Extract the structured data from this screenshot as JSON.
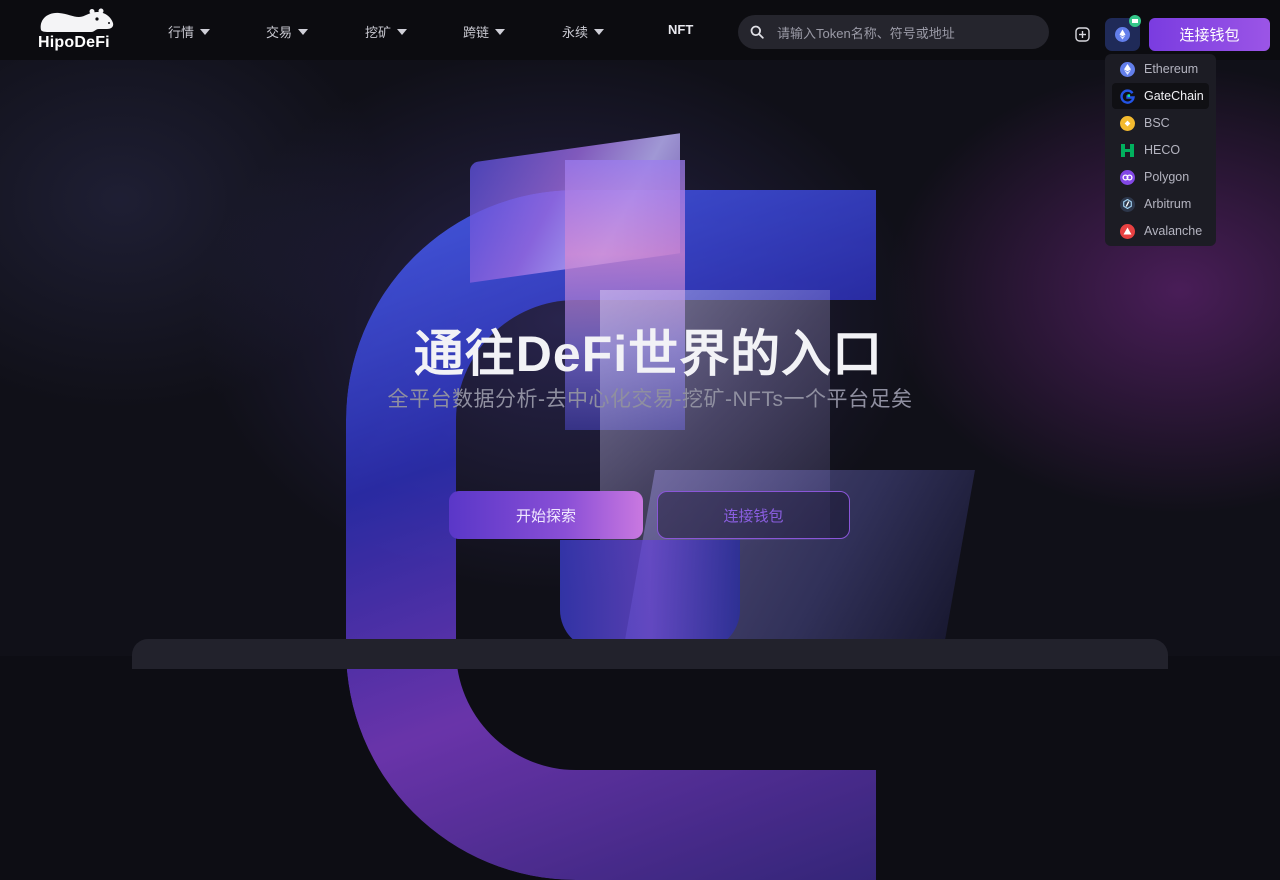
{
  "header": {
    "logo_text": "HipoDeFi",
    "nav": [
      {
        "label": "行情"
      },
      {
        "label": "交易"
      },
      {
        "label": "挖矿"
      },
      {
        "label": "跨链"
      },
      {
        "label": "永续"
      }
    ],
    "nft_label": "NFT",
    "search_placeholder": "请输入Token名称、符号或地址",
    "connect_label": "连接钱包"
  },
  "chain_dropdown": {
    "items": [
      {
        "label": "Ethereum",
        "icon": "ethereum-icon",
        "color": "#627eea"
      },
      {
        "label": "GateChain",
        "icon": "gatechain-icon",
        "color": "#2354e6",
        "active": true
      },
      {
        "label": "BSC",
        "icon": "bsc-icon",
        "color": "#f3ba2f"
      },
      {
        "label": "HECO",
        "icon": "heco-icon",
        "color": "#01943f"
      },
      {
        "label": "Polygon",
        "icon": "polygon-icon",
        "color": "#8247e5"
      },
      {
        "label": "Arbitrum",
        "icon": "arbitrum-icon",
        "color": "#2d374b"
      },
      {
        "label": "Avalanche",
        "icon": "avalanche-icon",
        "color": "#e84142"
      }
    ]
  },
  "hero": {
    "title": "通往DeFi世界的入口",
    "subtitle": "全平台数据分析-去中心化交易-挖矿-NFTs一个平台足矣",
    "explore_label": "开始探索",
    "connect_label": "连接钱包"
  }
}
